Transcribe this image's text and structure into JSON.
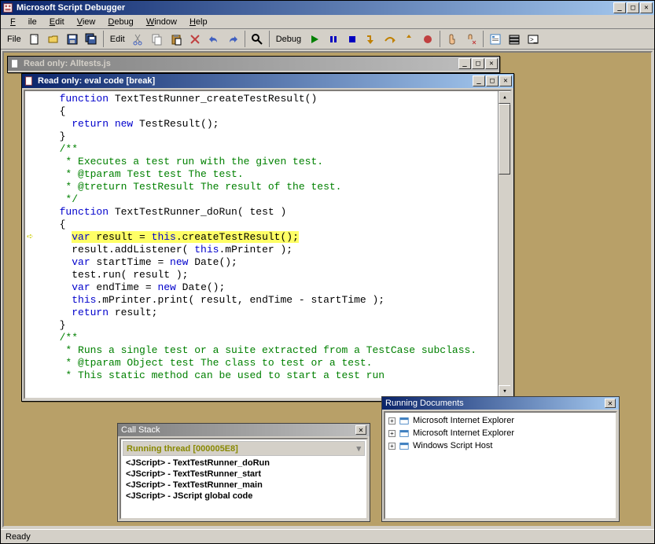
{
  "window": {
    "title": "Microsoft Script Debugger"
  },
  "menu": {
    "file": "File",
    "edit": "Edit",
    "view": "View",
    "debug": "Debug",
    "window": "Window",
    "help": "Help"
  },
  "toolbar": {
    "file_label": "File",
    "edit_label": "Edit",
    "debug_label": "Debug"
  },
  "doc_outer": {
    "title": "Read only: Alltests.js"
  },
  "doc_inner": {
    "title": "Read only: eval code [break]"
  },
  "code": {
    "lines": [
      {
        "indent": 2,
        "spans": [
          [
            "blue",
            "function"
          ],
          [
            "black",
            " TextTestRunner_createTestResult()"
          ]
        ]
      },
      {
        "indent": 2,
        "spans": [
          [
            "black",
            "{"
          ]
        ]
      },
      {
        "indent": 4,
        "spans": [
          [
            "blue",
            "return new"
          ],
          [
            "black",
            " TestResult();"
          ]
        ]
      },
      {
        "indent": 2,
        "spans": [
          [
            "black",
            "}"
          ]
        ]
      },
      {
        "indent": 2,
        "spans": [
          [
            "green",
            "/**"
          ]
        ]
      },
      {
        "indent": 2,
        "spans": [
          [
            "green",
            " * Executes a test run with the given test."
          ]
        ]
      },
      {
        "indent": 2,
        "spans": [
          [
            "green",
            " * @tparam Test test The test."
          ]
        ]
      },
      {
        "indent": 2,
        "spans": [
          [
            "green",
            " * @treturn TestResult The result of the test."
          ]
        ]
      },
      {
        "indent": 2,
        "spans": [
          [
            "green",
            " */"
          ]
        ]
      },
      {
        "indent": 2,
        "spans": [
          [
            "blue",
            "function"
          ],
          [
            "black",
            " TextTestRunner_doRun( test )"
          ]
        ]
      },
      {
        "indent": 2,
        "spans": [
          [
            "black",
            "{"
          ]
        ]
      },
      {
        "indent": 4,
        "hl": true,
        "spans": [
          [
            "blue",
            "var"
          ],
          [
            "black",
            " result = "
          ],
          [
            "blue",
            "this"
          ],
          [
            "black",
            ".createTestResult();"
          ]
        ]
      },
      {
        "indent": 4,
        "spans": [
          [
            "black",
            "result.addListener( "
          ],
          [
            "blue",
            "this"
          ],
          [
            "black",
            ".mPrinter );"
          ]
        ]
      },
      {
        "indent": 4,
        "spans": [
          [
            "blue",
            "var"
          ],
          [
            "black",
            " startTime = "
          ],
          [
            "blue",
            "new"
          ],
          [
            "black",
            " Date();"
          ]
        ]
      },
      {
        "indent": 4,
        "spans": [
          [
            "black",
            "test.run( result );"
          ]
        ]
      },
      {
        "indent": 4,
        "spans": [
          [
            "blue",
            "var"
          ],
          [
            "black",
            " endTime = "
          ],
          [
            "blue",
            "new"
          ],
          [
            "black",
            " Date();"
          ]
        ]
      },
      {
        "indent": 4,
        "spans": [
          [
            "blue",
            "this"
          ],
          [
            "black",
            ".mPrinter.print( result, endTime - startTime );"
          ]
        ]
      },
      {
        "indent": 4,
        "spans": [
          [
            "blue",
            "return"
          ],
          [
            "black",
            " result;"
          ]
        ]
      },
      {
        "indent": 2,
        "spans": [
          [
            "black",
            "}"
          ]
        ]
      },
      {
        "indent": 2,
        "spans": [
          [
            "green",
            "/**"
          ]
        ]
      },
      {
        "indent": 2,
        "spans": [
          [
            "green",
            " * Runs a single test or a suite extracted from a TestCase subclass."
          ]
        ]
      },
      {
        "indent": 2,
        "spans": [
          [
            "green",
            " * @tparam Object test The class to test or a test."
          ]
        ]
      },
      {
        "indent": 2,
        "spans": [
          [
            "green",
            " * This static method can be used to start a test run"
          ]
        ]
      }
    ],
    "break_line_index": 11
  },
  "call_stack": {
    "title": "Call Stack",
    "header": "Running thread   [000005E8]",
    "items": [
      "<JScript> - TextTestRunner_doRun",
      "<JScript> - TextTestRunner_start",
      "<JScript> - TextTestRunner_main",
      "<JScript> - JScript global code"
    ]
  },
  "running_docs": {
    "title": "Running Documents",
    "items": [
      "Microsoft Internet Explorer",
      "Microsoft Internet Explorer",
      "Windows Script Host"
    ]
  },
  "status": {
    "text": "Ready"
  }
}
